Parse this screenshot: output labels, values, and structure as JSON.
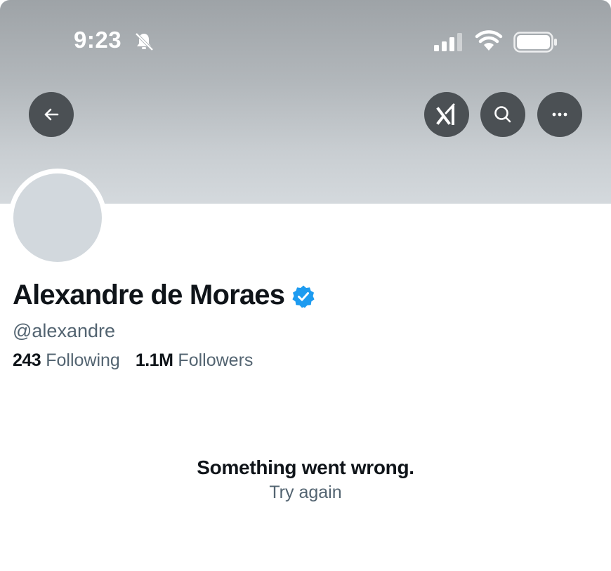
{
  "status_bar": {
    "time": "9:23",
    "icons": [
      "bell-slash-icon",
      "cellular-signal-icon",
      "wifi-icon",
      "battery-icon"
    ]
  },
  "header": {
    "buttons": [
      {
        "name": "back-button",
        "icon": "arrow-left-icon"
      },
      {
        "name": "grok-button",
        "icon": "grok-icon"
      },
      {
        "name": "search-button",
        "icon": "search-icon"
      },
      {
        "name": "more-button",
        "icon": "more-horizontal-icon"
      }
    ]
  },
  "profile": {
    "display_name": "Alexandre de Moraes",
    "verified_icon": "verified-badge-icon",
    "handle": "@alexandre",
    "following_count": "243",
    "following_label": "Following",
    "followers_count": "1.1M",
    "followers_label": "Followers"
  },
  "error": {
    "message": "Something went wrong.",
    "retry_label": "Try again"
  },
  "colors": {
    "banner_top": "#9ea3a7",
    "banner_bottom": "#d4d9dd",
    "button_bg": "#4b5054",
    "verified_blue": "#1d9bf0",
    "primary_text": "#0f1419",
    "secondary_text": "#536471",
    "avatar_placeholder": "#d2d8dd"
  }
}
